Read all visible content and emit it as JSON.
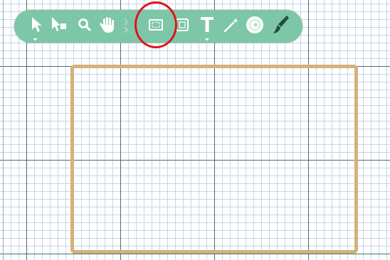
{
  "toolbar": {
    "tools": [
      {
        "name": "select-tool",
        "icon": "arrow-pointer-icon",
        "has_dropdown": true
      },
      {
        "name": "direct-select-tool",
        "icon": "arrow-with-node-icon",
        "has_dropdown": false
      },
      {
        "name": "zoom-tool",
        "icon": "magnifier-icon",
        "has_dropdown": false
      },
      {
        "name": "pan-tool",
        "icon": "hand-icon",
        "has_dropdown": false
      },
      {
        "name": "artboard-tool",
        "icon": "artboard-frame-icon",
        "has_dropdown": false
      },
      {
        "name": "frame-tool",
        "icon": "frame-box-icon",
        "has_dropdown": false
      },
      {
        "name": "text-tool",
        "icon": "text-t-icon",
        "has_dropdown": true
      },
      {
        "name": "magic-wand-tool",
        "icon": "magic-wand-icon",
        "has_dropdown": false
      },
      {
        "name": "gradient-tool",
        "icon": "spiral-gradient-icon",
        "has_dropdown": false
      },
      {
        "name": "brush-tool",
        "icon": "paintbrush-icon",
        "has_dropdown": false
      }
    ],
    "highlighted_tool": "artboard-tool"
  },
  "colors": {
    "toolbar_bg": "#7ec6a8",
    "icon": "#ffffff",
    "icon_dark": "#1f4d3e",
    "artboard_border": "#d4b27a",
    "highlight_ring": "#e0141b",
    "major_grid": "#2f6050",
    "minor_grid": "#c6d5e8"
  }
}
